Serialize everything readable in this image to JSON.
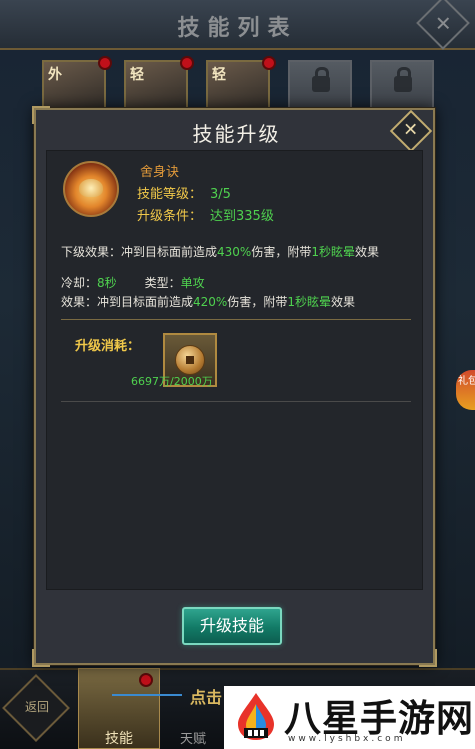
{
  "background": {
    "title": "技能列表",
    "portrait_tags": [
      "外",
      "轻",
      "轻"
    ],
    "bottom_nav": {
      "back_label": "返回",
      "skill_label": "技能",
      "talent_label": "天赋",
      "tap_hint": "点击"
    },
    "side_badge": "礼包"
  },
  "modal": {
    "title": "技能升级",
    "skill": {
      "name": "舍身诀",
      "level_label": "技能等级：",
      "level_value": "3/5",
      "condition_label": "升级条件：",
      "condition_value": "达到335级"
    },
    "next_effect": {
      "prefix": "下级效果：冲到目标面前造成",
      "percent": "430%",
      "mid": "伤害，附带",
      "stun": "1秒眩晕",
      "suffix": "效果"
    },
    "cooldown": {
      "label": "冷却：",
      "value": "8秒",
      "type_label": "类型：",
      "type_value": "单攻"
    },
    "current_effect": {
      "prefix": "效果：冲到目标面前造成",
      "percent": "420%",
      "mid": "伤害，附带",
      "stun": "1秒眩晕",
      "suffix": "效果"
    },
    "cost": {
      "label": "升级消耗：",
      "amount": "6697万/2000万"
    },
    "upgrade_button": "升级技能"
  },
  "watermark": {
    "text": "八星手游网",
    "url": "www.lyshbx.com"
  },
  "colors": {
    "green": "#4fd14f",
    "gold": "#f0c84a",
    "orange": "#e29a3a",
    "button": "#127a66"
  }
}
